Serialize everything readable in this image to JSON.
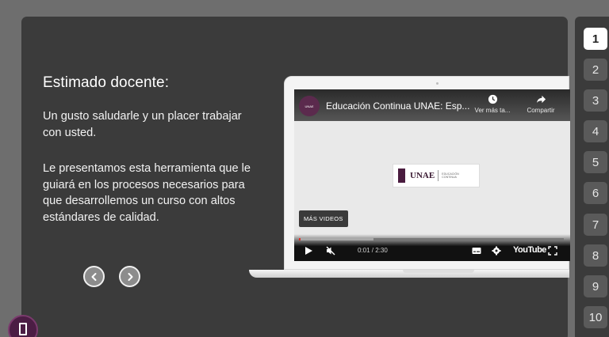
{
  "slide": {
    "greeting": "Estimado docente:",
    "paragraph1": "Un gusto saludarle y un placer trabajar con usted.",
    "paragraph2": "Le presentamos esta herramienta que le guiará en los procesos necesarios para que desarrollemos un curso con altos estándares de calidad."
  },
  "video": {
    "title": "Educación Continua UNAE: Esp...",
    "channel_badge": "UNAE",
    "watch_later": "Ver más ta...",
    "share": "Compartir",
    "logo_name": "UNAE",
    "logo_sub": "EDUCACIÓN CONTINUA",
    "more_videos": "MÁS VIDEOS",
    "time": "0:01 / 2:30",
    "brand": "YouTube",
    "progress_fraction": 0.007,
    "buffered_fraction": 0.28
  },
  "navigation": {
    "prev_icon": "chevron-left-icon",
    "next_icon": "chevron-right-icon",
    "pages": [
      "1",
      "2",
      "3",
      "4",
      "5",
      "6",
      "7",
      "8",
      "9",
      "10"
    ],
    "active_page": "1"
  },
  "colors": {
    "background": "#6e6e6e",
    "panel": "#3b3b3b",
    "brand": "#4b1d44",
    "progress": "#e0312b"
  }
}
